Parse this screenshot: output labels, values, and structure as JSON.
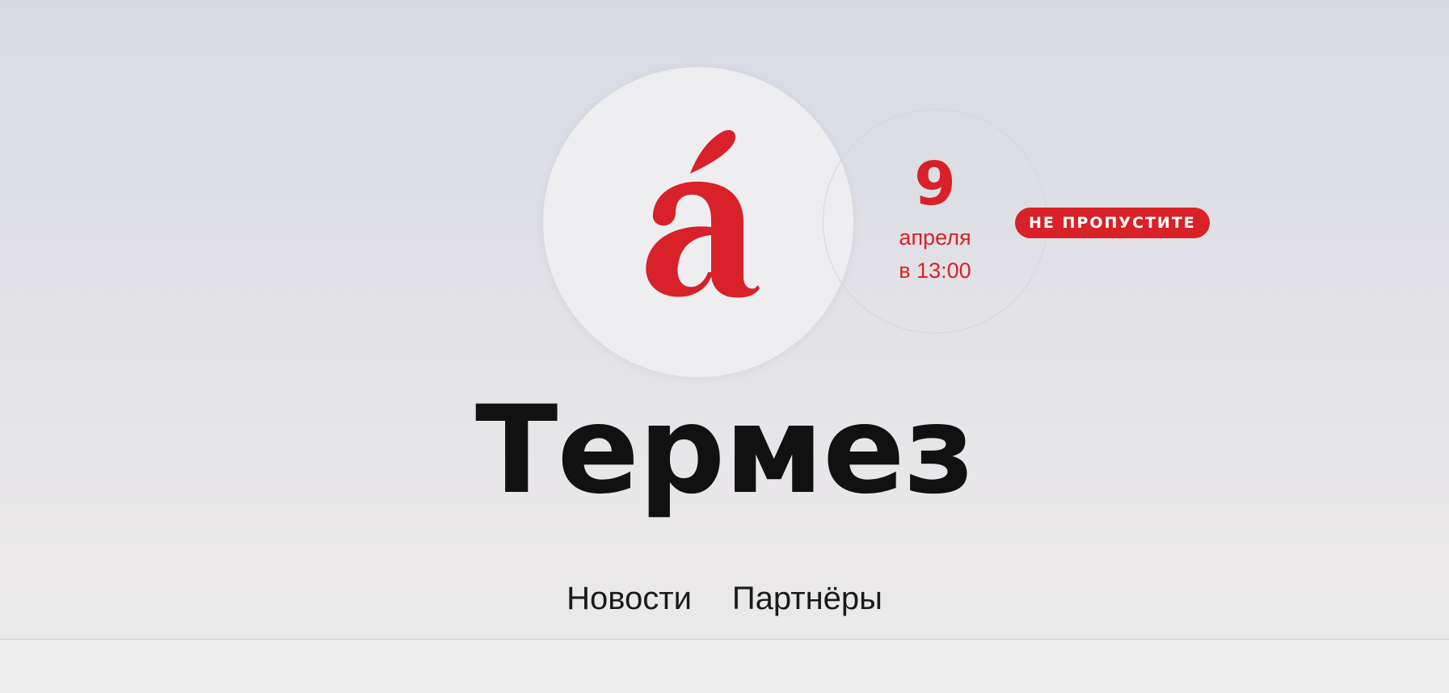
{
  "brand": {
    "logo_glyph": "á",
    "logo_color": "#d82128",
    "logo_icon": "brand-a-acute-icon"
  },
  "event": {
    "day": "9",
    "month": "апреля",
    "time": "в 13:00",
    "badge_label": "НЕ ПРОПУСТИТЕ",
    "accent_color": "#d82128"
  },
  "page": {
    "title": "Термез"
  },
  "nav": {
    "items": [
      {
        "label": "Новости"
      },
      {
        "label": "Партнёры"
      }
    ]
  }
}
